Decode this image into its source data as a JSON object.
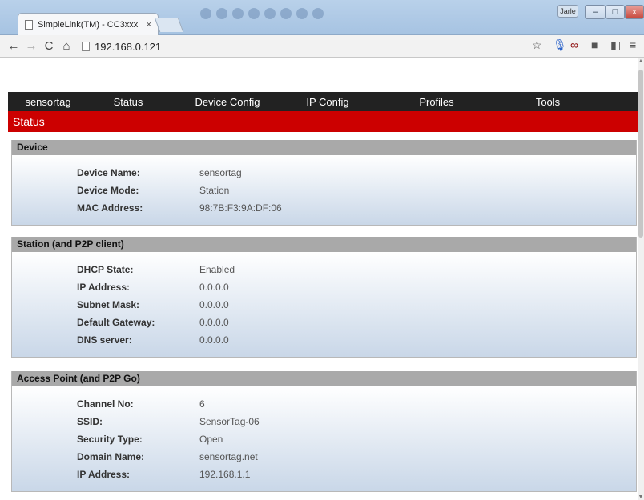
{
  "browser": {
    "tab_title": "SimpleLink(TM) - CC3xxx",
    "tab_close": "×",
    "user_badge": "Jarle",
    "url": "192.168.0.121"
  },
  "nav": {
    "items": [
      "sensortag",
      "Status",
      "Device Config",
      "IP Config",
      "Profiles",
      "Tools"
    ]
  },
  "page": {
    "status_title": "Status"
  },
  "sections": [
    {
      "title": "Device",
      "rows": [
        {
          "label": "Device Name:",
          "value": "sensortag"
        },
        {
          "label": "Device Mode:",
          "value": "Station"
        },
        {
          "label": "MAC Address:",
          "value": "98:7B:F3:9A:DF:06"
        }
      ]
    },
    {
      "title": "Station (and P2P client)",
      "rows": [
        {
          "label": "DHCP State:",
          "value": "Enabled"
        },
        {
          "label": "IP Address:",
          "value": "0.0.0.0"
        },
        {
          "label": "Subnet Mask:",
          "value": "0.0.0.0"
        },
        {
          "label": "Default Gateway:",
          "value": "0.0.0.0"
        },
        {
          "label": "DNS server:",
          "value": "0.0.0.0"
        }
      ]
    },
    {
      "title": "Access Point (and P2P Go)",
      "rows": [
        {
          "label": "Channel No:",
          "value": "6"
        },
        {
          "label": "SSID:",
          "value": "SensorTag-06"
        },
        {
          "label": "Security Type:",
          "value": "Open"
        },
        {
          "label": "Domain Name:",
          "value": "sensortag.net"
        },
        {
          "label": "IP Address:",
          "value": "192.168.1.1"
        }
      ]
    }
  ],
  "colors": {
    "nav_bg": "#222222",
    "status_bar": "#cc0000",
    "section_head": "#a9a9a9"
  }
}
